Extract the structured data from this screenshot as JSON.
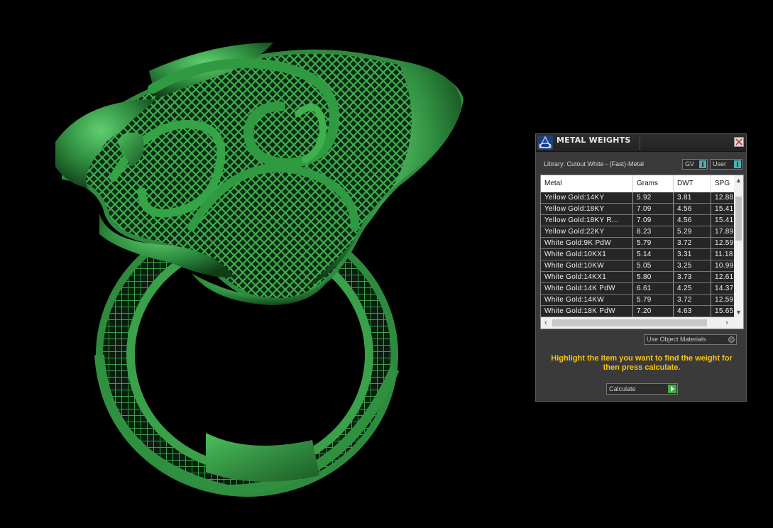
{
  "panel": {
    "title": "METAL WEIGHTS",
    "library_label": "Library: Cutout White - (Fast)-Metal",
    "toggle_gv": "GV",
    "toggle_user": "User",
    "use_object_materials": "Use Object Materials",
    "hint": "Highlight the item you want to find the weight for then press calculate.",
    "calculate_label": "Calculate"
  },
  "table": {
    "headers": {
      "metal": "Metal",
      "grams": "Grams",
      "dwt": "DWT",
      "spg": "SPG"
    },
    "rows": [
      {
        "metal": "Yellow Gold:14KY",
        "grams": "5.92",
        "dwt": "3.81",
        "spg": "12.88"
      },
      {
        "metal": "Yellow Gold:18KY",
        "grams": "7.09",
        "dwt": "4.56",
        "spg": "15.41"
      },
      {
        "metal": "Yellow Gold:18KY R...",
        "grams": "7.09",
        "dwt": "4.56",
        "spg": "15.41"
      },
      {
        "metal": "Yellow Gold:22KY",
        "grams": "8.23",
        "dwt": "5.29",
        "spg": "17.89"
      },
      {
        "metal": "White Gold:9K PdW",
        "grams": "5.79",
        "dwt": "3.72",
        "spg": "12.59"
      },
      {
        "metal": "White Gold:10KX1",
        "grams": "5.14",
        "dwt": "3.31",
        "spg": "11.18"
      },
      {
        "metal": "White Gold:10KW",
        "grams": "5.05",
        "dwt": "3.25",
        "spg": "10.99"
      },
      {
        "metal": "White Gold:14KX1",
        "grams": "5.80",
        "dwt": "3.73",
        "spg": "12.61"
      },
      {
        "metal": "White Gold:14K PdW",
        "grams": "6.61",
        "dwt": "4.25",
        "spg": "14.37"
      },
      {
        "metal": "White Gold:14KW",
        "grams": "5.79",
        "dwt": "3.72",
        "spg": "12.59"
      },
      {
        "metal": "White Gold:18K PdW",
        "grams": "7.20",
        "dwt": "4.63",
        "spg": "15.65"
      }
    ]
  },
  "colors": {
    "model_green": "#2e8b3e",
    "hint_yellow": "#f5c518",
    "panel_bg": "#3a3a3a"
  }
}
